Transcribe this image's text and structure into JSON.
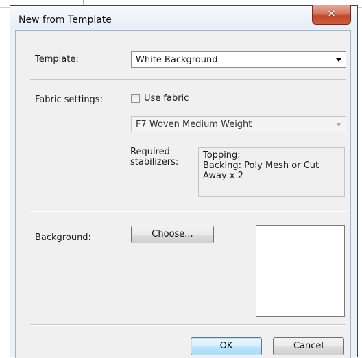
{
  "window": {
    "title": "New from Template",
    "close_glyph": "✕"
  },
  "template": {
    "label": "Template:",
    "selected": "White Background"
  },
  "fabric": {
    "label": "Fabric settings:",
    "use_fabric_label": "Use fabric",
    "use_fabric_checked": false,
    "fabric_selected": "F7 Woven Medium Weight",
    "fabric_enabled": false,
    "stabilizers_label_line1": "Required",
    "stabilizers_label_line2": "stabilizers:",
    "stabilizers_lines": [
      "Topping:",
      "Backing: Poly Mesh or Cut",
      "Away x 2"
    ]
  },
  "background": {
    "label": "Background:",
    "choose_label": "Choose..."
  },
  "buttons": {
    "ok": "OK",
    "cancel": "Cancel"
  },
  "colors": {
    "dialog_bg": "#f0f0f0",
    "close_button": "#c2472b",
    "default_button_border": "#3c7fb1"
  },
  "icons": {
    "close": "close-icon",
    "dropdown": "chevron-down-icon"
  }
}
